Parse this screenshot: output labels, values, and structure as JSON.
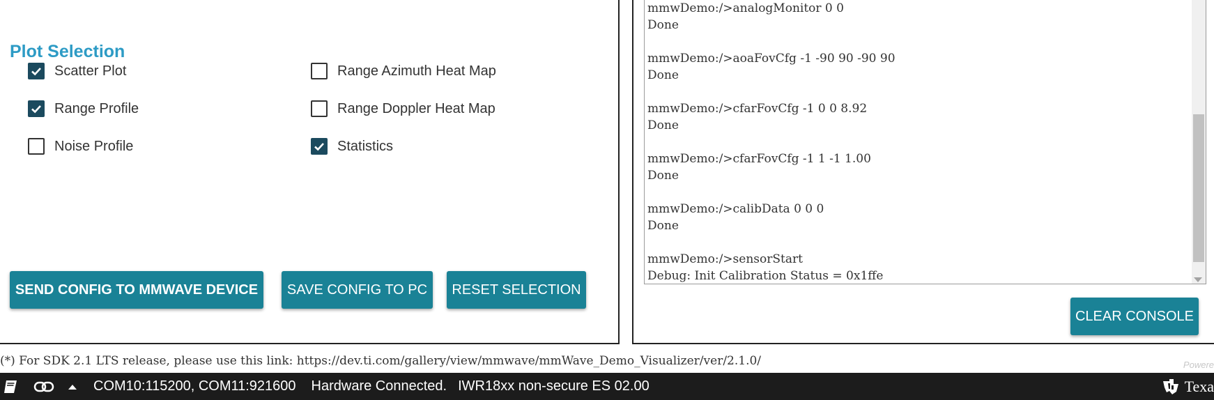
{
  "plot_selection": {
    "title": "Plot Selection",
    "items": [
      {
        "label": "Scatter Plot",
        "checked": true
      },
      {
        "label": "Range Profile",
        "checked": true
      },
      {
        "label": "Noise Profile",
        "checked": false
      },
      {
        "label": "Range Azimuth Heat Map",
        "checked": false
      },
      {
        "label": "Range Doppler Heat Map",
        "checked": false
      },
      {
        "label": "Statistics",
        "checked": true
      }
    ]
  },
  "buttons": {
    "send_config": "SEND CONFIG TO MMWAVE DEVICE",
    "save_config": "SAVE CONFIG TO PC",
    "reset_selection": "RESET SELECTION",
    "clear_console": "CLEAR CONSOLE"
  },
  "console": {
    "lines": [
      "mmwDemo:/>analogMonitor 0 0",
      "Done",
      "",
      "mmwDemo:/>aoaFovCfg -1 -90 90 -90 90",
      "Done",
      "",
      "mmwDemo:/>cfarFovCfg -1 0 0 8.92",
      "Done",
      "",
      "mmwDemo:/>cfarFovCfg -1 1 -1 1.00",
      "Done",
      "",
      "mmwDemo:/>calibData 0 0 0",
      "Done",
      "",
      "mmwDemo:/>sensorStart",
      "Debug: Init Calibration Status = 0x1ffe"
    ]
  },
  "footer_note": "(*) For SDK 2.1 LTS release, please use this link: https://dev.ti.com/gallery/view/mmwave/mmWave_Demo_Visualizer/ver/2.1.0/",
  "powered_text": "Powere",
  "status_bar": {
    "port": "COM10:115200, COM11:921600",
    "connection": "Hardware Connected.",
    "device": "IWR18xx non-secure ES 02.00",
    "brand": "Texa"
  },
  "icons": {
    "book": "book-icon",
    "link": "link-icon",
    "expand": "chevron-up-icon",
    "logo": "ti-logo-icon"
  },
  "colors": {
    "accent_title": "#2d9bc5",
    "button": "#1a8296",
    "checkbox_on": "#1b4a5e",
    "status_bar": "#1c1c1c"
  }
}
